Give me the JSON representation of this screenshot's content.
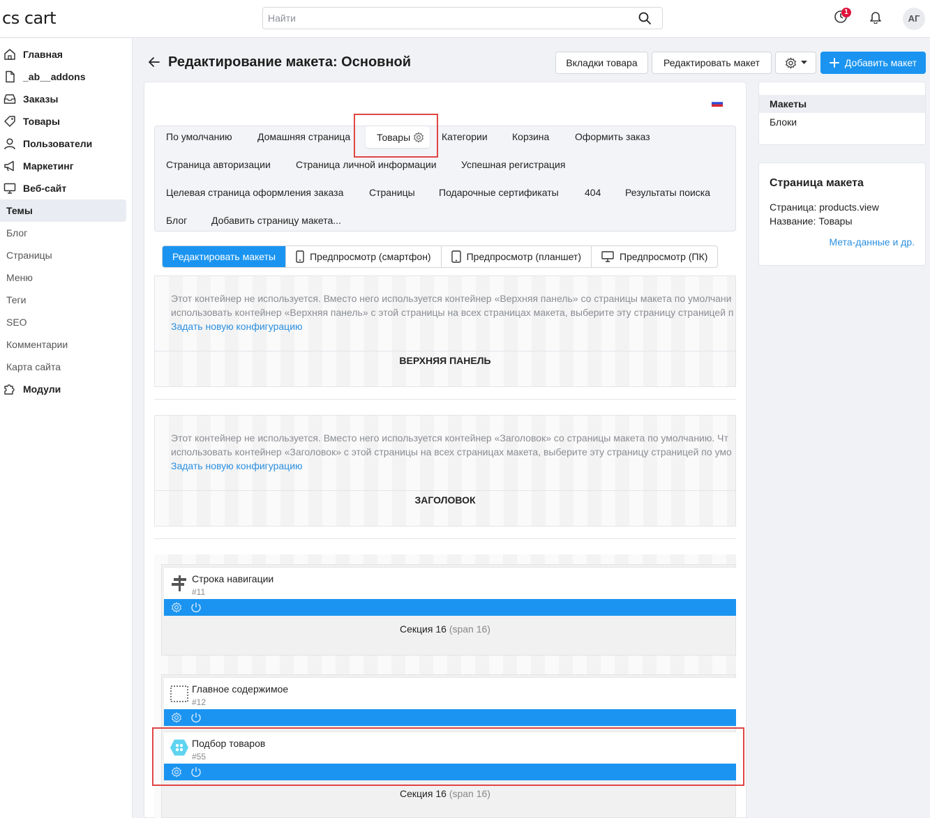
{
  "header": {
    "logo": "cs cart",
    "search_placeholder": "Найти",
    "notification_count": "1",
    "avatar_initials": "АГ"
  },
  "sidebar": {
    "items": [
      {
        "label": "Главная",
        "icon": "home-icon"
      },
      {
        "label": "_ab__addons",
        "icon": "file-icon"
      },
      {
        "label": "Заказы",
        "icon": "inbox-icon"
      },
      {
        "label": "Товары",
        "icon": "tag-icon"
      },
      {
        "label": "Пользователи",
        "icon": "user-icon"
      },
      {
        "label": "Маркетинг",
        "icon": "megaphone-icon"
      },
      {
        "label": "Веб-сайт",
        "icon": "monitor-icon"
      }
    ],
    "website_sub": [
      "Темы",
      "Блог",
      "Страницы",
      "Меню",
      "Теги",
      "SEO",
      "Комментарии",
      "Карта сайта"
    ],
    "modules": {
      "label": "Модули",
      "icon": "puzzle-icon"
    }
  },
  "page": {
    "title": "Редактирование макета: Основной",
    "buttons": {
      "product_tabs": "Вкладки товара",
      "edit_layout": "Редактировать макет",
      "add_layout": "Добавить макет"
    }
  },
  "layout_tabs": [
    "По умолчанию",
    "Домашняя страница",
    "Товары",
    "Категории",
    "Корзина",
    "Оформить заказ",
    "Страница авторизации",
    "Страница личной информации",
    "Успешная регистрация",
    "Целевая страница оформления заказа",
    "Страницы",
    "Подарочные сертификаты",
    "404",
    "Результаты поиска",
    "Блог",
    "Добавить страницу макета..."
  ],
  "active_layout_tab": "Товары",
  "mode_tabs": [
    "Редактировать макеты",
    "Предпросмотр (смартфон)",
    "Предпросмотр (планшет)",
    "Предпросмотр (ПК)"
  ],
  "containers": {
    "top_panel": {
      "notice_line1": "Этот контейнер не используется. Вместо него используется контейнер «Верхняя панель» со страницы макета по умолчани",
      "notice_line2": "использовать контейнер «Верхняя панель» с этой страницы на всех страницах макета, выберите эту страницу страницей п",
      "link": "Задать новую конфигурацию",
      "name": "ВЕРХНЯЯ ПАНЕЛЬ"
    },
    "header": {
      "notice_line1": "Этот контейнер не используется. Вместо него используется контейнер «Заголовок» со страницы макета по умолчанию. Чт",
      "notice_line2": "использовать контейнер «Заголовок» с этой страницы на всех страницах макета, выберите эту страницу страницей по умо",
      "link": "Задать новую конфигурацию",
      "name": "ЗАГОЛОВОК"
    }
  },
  "blocks": [
    {
      "title": "Строка навигации",
      "id": "#11",
      "icon": "signpost-icon"
    },
    {
      "title": "Главное содержимое",
      "id": "#12",
      "icon": "dotted-square-icon"
    },
    {
      "title": "Подбор товаров",
      "id": "#55",
      "icon": "hexagon-filter-icon"
    }
  ],
  "sections": {
    "first": {
      "name": "Секция 16",
      "span": "(span 16)"
    },
    "second": {
      "name": "Секция 16",
      "span": "(span 16)"
    }
  },
  "right_panel": {
    "nav": [
      "Макеты",
      "Блоки"
    ],
    "active_nav": "Макеты",
    "info_title": "Страница макета",
    "page_line": "Страница: products.view",
    "name_line": "Название: Товары",
    "meta_link": "Мета-данные и др."
  },
  "colors": {
    "accent": "#1a94f0",
    "highlight": "#e04545",
    "badge": "#e0143c"
  }
}
